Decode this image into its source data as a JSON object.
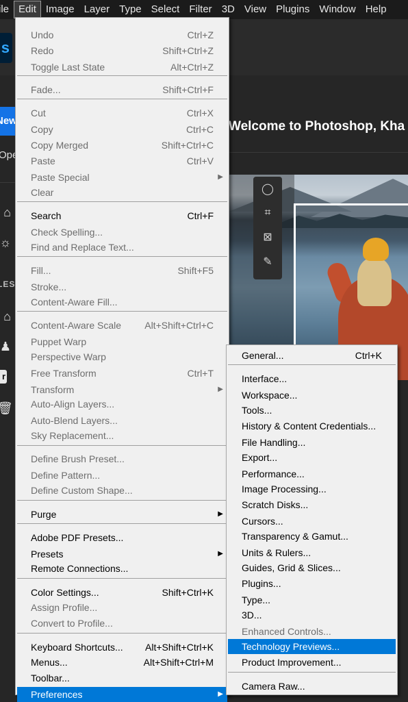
{
  "menubar": {
    "items": [
      "ile",
      "Edit",
      "Image",
      "Layer",
      "Type",
      "Select",
      "Filter",
      "3D",
      "View",
      "Plugins",
      "Window",
      "Help"
    ],
    "active_index": 1
  },
  "home": {
    "logo": "s",
    "new_label": "New",
    "open_label": "Ope",
    "welcome": "Welcome to Photoshop, Kha",
    "files_label": "LES",
    "badge": "r"
  },
  "edit_menu": {
    "items": [
      {
        "label": "Undo",
        "shortcut": "Ctrl+Z",
        "disabled": true
      },
      {
        "label": "Redo",
        "shortcut": "Shift+Ctrl+Z",
        "disabled": true
      },
      {
        "label": "Toggle Last State",
        "shortcut": "Alt+Ctrl+Z",
        "disabled": true
      },
      {
        "label": "Fade...",
        "shortcut": "Shift+Ctrl+F",
        "disabled": true
      },
      {
        "label": "Cut",
        "shortcut": "Ctrl+X",
        "disabled": true
      },
      {
        "label": "Copy",
        "shortcut": "Ctrl+C",
        "disabled": true
      },
      {
        "label": "Copy Merged",
        "shortcut": "Shift+Ctrl+C",
        "disabled": true
      },
      {
        "label": "Paste",
        "shortcut": "Ctrl+V",
        "disabled": true
      },
      {
        "label": "Paste Special",
        "shortcut": "",
        "disabled": true,
        "submenu": true
      },
      {
        "label": "Clear",
        "shortcut": "",
        "disabled": true
      },
      {
        "label": "Search",
        "shortcut": "Ctrl+F",
        "disabled": false
      },
      {
        "label": "Check Spelling...",
        "shortcut": "",
        "disabled": true
      },
      {
        "label": "Find and Replace Text...",
        "shortcut": "",
        "disabled": true
      },
      {
        "label": "Fill...",
        "shortcut": "Shift+F5",
        "disabled": true
      },
      {
        "label": "Stroke...",
        "shortcut": "",
        "disabled": true
      },
      {
        "label": "Content-Aware Fill...",
        "shortcut": "",
        "disabled": true
      },
      {
        "label": "Content-Aware Scale",
        "shortcut": "Alt+Shift+Ctrl+C",
        "disabled": true
      },
      {
        "label": "Puppet Warp",
        "shortcut": "",
        "disabled": true
      },
      {
        "label": "Perspective Warp",
        "shortcut": "",
        "disabled": true
      },
      {
        "label": "Free Transform",
        "shortcut": "Ctrl+T",
        "disabled": true
      },
      {
        "label": "Transform",
        "shortcut": "",
        "disabled": true,
        "submenu": true
      },
      {
        "label": "Auto-Align Layers...",
        "shortcut": "",
        "disabled": true
      },
      {
        "label": "Auto-Blend Layers...",
        "shortcut": "",
        "disabled": true
      },
      {
        "label": "Sky Replacement...",
        "shortcut": "",
        "disabled": true
      },
      {
        "label": "Define Brush Preset...",
        "shortcut": "",
        "disabled": true
      },
      {
        "label": "Define Pattern...",
        "shortcut": "",
        "disabled": true
      },
      {
        "label": "Define Custom Shape...",
        "shortcut": "",
        "disabled": true
      },
      {
        "label": "Purge",
        "shortcut": "",
        "disabled": false,
        "submenu": true
      },
      {
        "label": "Adobe PDF Presets...",
        "shortcut": "",
        "disabled": false
      },
      {
        "label": "Presets",
        "shortcut": "",
        "disabled": false,
        "submenu": true
      },
      {
        "label": "Remote Connections...",
        "shortcut": "",
        "disabled": false
      },
      {
        "label": "Color Settings...",
        "shortcut": "Shift+Ctrl+K",
        "disabled": false
      },
      {
        "label": "Assign Profile...",
        "shortcut": "",
        "disabled": true
      },
      {
        "label": "Convert to Profile...",
        "shortcut": "",
        "disabled": true
      },
      {
        "label": "Keyboard Shortcuts...",
        "shortcut": "Alt+Shift+Ctrl+K",
        "disabled": false
      },
      {
        "label": "Menus...",
        "shortcut": "Alt+Shift+Ctrl+M",
        "disabled": false
      },
      {
        "label": "Toolbar...",
        "shortcut": "",
        "disabled": false
      },
      {
        "label": "Preferences",
        "shortcut": "",
        "disabled": false,
        "submenu": true,
        "highlighted": true
      }
    ]
  },
  "preferences_menu": {
    "items": [
      {
        "label": "General...",
        "shortcut": "Ctrl+K",
        "disabled": false
      },
      {
        "label": "Interface...",
        "shortcut": "",
        "disabled": false
      },
      {
        "label": "Workspace...",
        "shortcut": "",
        "disabled": false
      },
      {
        "label": "Tools...",
        "shortcut": "",
        "disabled": false
      },
      {
        "label": "History & Content Credentials...",
        "shortcut": "",
        "disabled": false
      },
      {
        "label": "File Handling...",
        "shortcut": "",
        "disabled": false
      },
      {
        "label": "Export...",
        "shortcut": "",
        "disabled": false
      },
      {
        "label": "Performance...",
        "shortcut": "",
        "disabled": false
      },
      {
        "label": "Image Processing...",
        "shortcut": "",
        "disabled": false
      },
      {
        "label": "Scratch Disks...",
        "shortcut": "",
        "disabled": false
      },
      {
        "label": "Cursors...",
        "shortcut": "",
        "disabled": false
      },
      {
        "label": "Transparency & Gamut...",
        "shortcut": "",
        "disabled": false
      },
      {
        "label": "Units & Rulers...",
        "shortcut": "",
        "disabled": false
      },
      {
        "label": "Guides, Grid & Slices...",
        "shortcut": "",
        "disabled": false
      },
      {
        "label": "Plugins...",
        "shortcut": "",
        "disabled": false
      },
      {
        "label": "Type...",
        "shortcut": "",
        "disabled": false
      },
      {
        "label": "3D...",
        "shortcut": "",
        "disabled": false
      },
      {
        "label": "Enhanced Controls...",
        "shortcut": "",
        "disabled": true
      },
      {
        "label": "Technology Previews...",
        "shortcut": "",
        "disabled": false,
        "highlighted": true
      },
      {
        "label": "Product Improvement...",
        "shortcut": "",
        "disabled": false
      },
      {
        "label": "Camera Raw...",
        "shortcut": "",
        "disabled": false
      }
    ]
  },
  "colors": {
    "highlight": "#0078d7",
    "menu_bg": "#f0f0f0",
    "disabled_text": "#6d6d6d",
    "accent_blue": "#1473e6"
  }
}
